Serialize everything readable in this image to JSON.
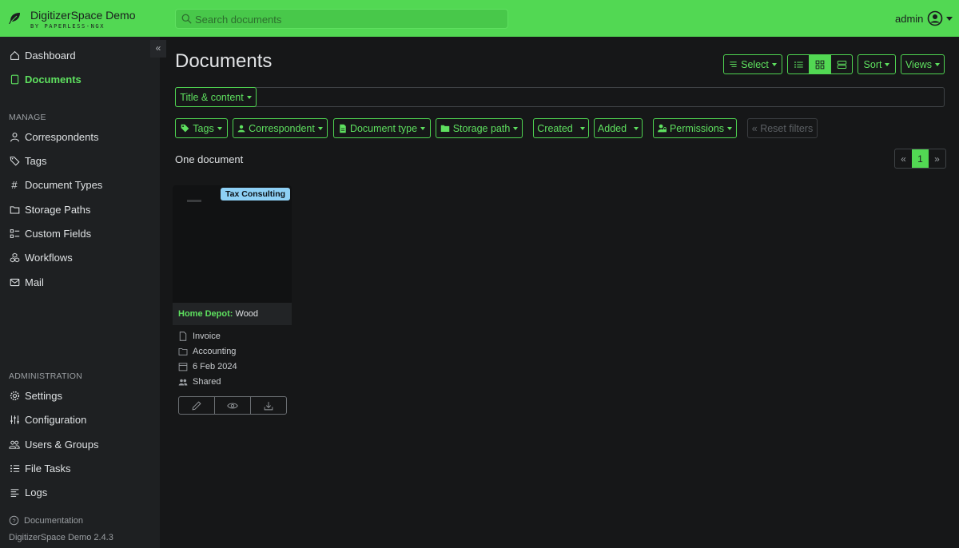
{
  "app": {
    "title": "DigitizerSpace Demo",
    "subtitle": "BY PAPERLESS-NGX",
    "accent": "#52d853"
  },
  "search": {
    "placeholder": "Search documents"
  },
  "user": {
    "name": "admin"
  },
  "sidebar": {
    "items": [
      {
        "label": "Dashboard",
        "icon": "house-icon"
      },
      {
        "label": "Documents",
        "icon": "file-icon",
        "active": true
      }
    ],
    "manage_header": "MANAGE",
    "manage": [
      {
        "label": "Correspondents",
        "icon": "person-icon"
      },
      {
        "label": "Tags",
        "icon": "tags-icon"
      },
      {
        "label": "Document Types",
        "icon": "hash-icon"
      },
      {
        "label": "Storage Paths",
        "icon": "folder-icon"
      },
      {
        "label": "Custom Fields",
        "icon": "ui-radios-icon"
      },
      {
        "label": "Workflows",
        "icon": "boxes-icon"
      },
      {
        "label": "Mail",
        "icon": "envelope-icon"
      }
    ],
    "admin_header": "ADMINISTRATION",
    "admin": [
      {
        "label": "Settings",
        "icon": "gear-icon"
      },
      {
        "label": "Configuration",
        "icon": "sliders-icon"
      },
      {
        "label": "Users & Groups",
        "icon": "people-icon"
      },
      {
        "label": "File Tasks",
        "icon": "list-task-icon"
      },
      {
        "label": "Logs",
        "icon": "text-left-icon"
      }
    ],
    "documentation": "Documentation",
    "version": "DigitizerSpace Demo 2.4.3"
  },
  "main": {
    "title": "Documents",
    "toolbar": {
      "select": "Select",
      "sort": "Sort",
      "views": "Views"
    },
    "query_mode": "Title & content",
    "filters": {
      "tags": "Tags",
      "correspondent": "Correspondent",
      "document_type": "Document type",
      "storage_path": "Storage path",
      "created": "Created",
      "added": "Added",
      "permissions": "Permissions",
      "reset": "« Reset filters"
    },
    "count": "One document",
    "pager": {
      "prev": "«",
      "current": "1",
      "next": "»"
    }
  },
  "card": {
    "tag": "Tax Consulting",
    "tag_color": "#8ed0f5",
    "correspondent": "Home Depot",
    "separator": ":",
    "title": " Wood",
    "document_type": "Invoice",
    "storage_path": "Accounting",
    "created": "6 Feb 2024",
    "sharing": "Shared"
  }
}
